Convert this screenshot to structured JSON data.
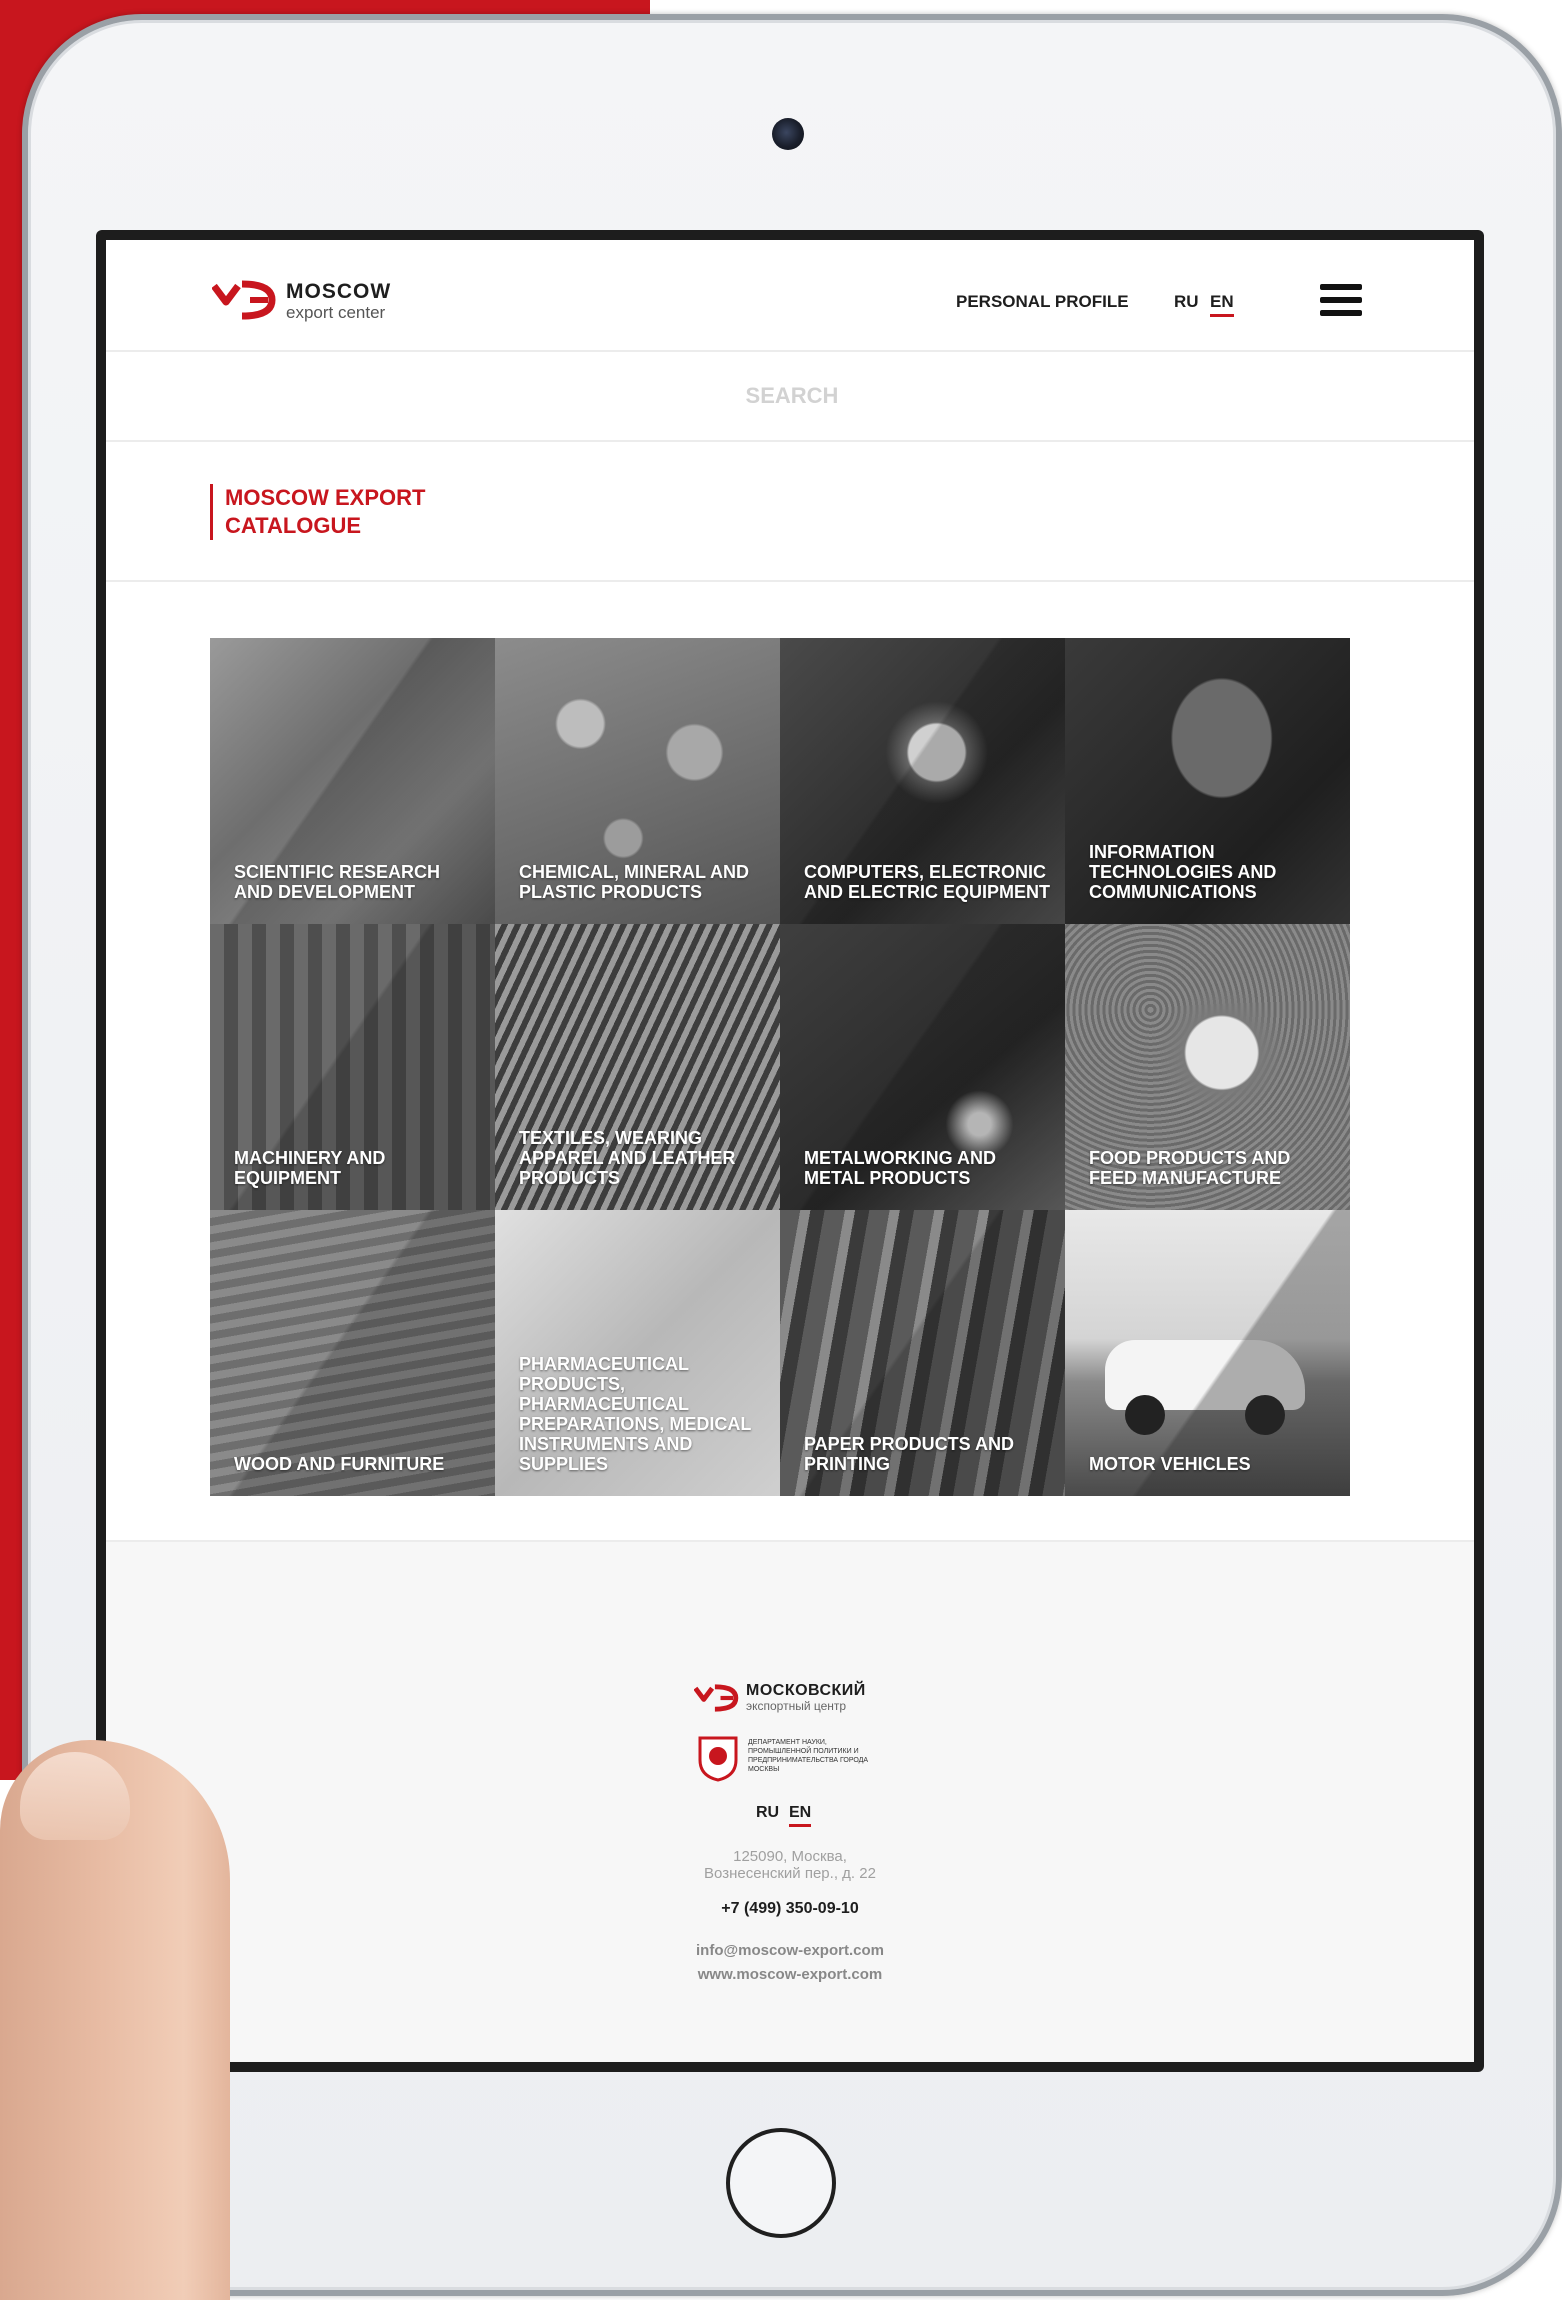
{
  "header": {
    "logo_title": "MOSCOW",
    "logo_subtitle": "export center",
    "profile_link": "PERSONAL PROFILE",
    "lang_ru": "RU",
    "lang_en": "EN",
    "active_lang": "EN",
    "menu_icon": "hamburger-icon"
  },
  "search": {
    "placeholder": "SEARCH"
  },
  "catalogue": {
    "title": "MOSCOW EXPORT CATALOGUE",
    "categories": [
      {
        "label": "SCIENTIFIC RESEARCH AND DEVELOPMENT"
      },
      {
        "label": "CHEMICAL, MINERAL AND PLASTIC PRODUCTS"
      },
      {
        "label": "COMPUTERS, ELECTRONIC AND ELECTRIC EQUIPMENT"
      },
      {
        "label": "INFORMATION TECHNOLOGIES AND COMMUNICATIONS"
      },
      {
        "label": "MACHINERY AND EQUIPMENT"
      },
      {
        "label": "TEXTILES, WEARING APPAREL AND LEATHER PRODUCTS"
      },
      {
        "label": "METALWORKING AND METAL PRODUCTS"
      },
      {
        "label": "FOOD PRODUCTS AND FEED MANUFACTURE"
      },
      {
        "label": "WOOD AND FURNITURE"
      },
      {
        "label": "PHARMACEUTICAL PRODUCTS, PHARMACEUTICAL PREPARATIONS, MEDICAL INSTRUMENTS AND SUPPLIES"
      },
      {
        "label": "PAPER PRODUCTS AND PRINTING"
      },
      {
        "label": "MOTOR VEHICLES"
      }
    ]
  },
  "footer": {
    "logo_title": "МОСКОВСКИЙ",
    "logo_subtitle": "экспортный центр",
    "dept_text": "ДЕПАРТАМЕНТ НАУКИ, ПРОМЫШЛЕННОЙ ПОЛИТИКИ И ПРЕДПРИНИМАТЕЛЬСТВА ГОРОДА МОСКВЫ",
    "lang_ru": "RU",
    "lang_en": "EN",
    "address_line1": "125090, Москва,",
    "address_line2": "Вознесенский пер., д. 22",
    "phone": "+7 (499) 350-09-10",
    "email": "info@moscow-export.com",
    "website": "www.moscow-export.com"
  },
  "colors": {
    "brand_red": "#c8161e",
    "text_dark": "#1e1e1e"
  }
}
